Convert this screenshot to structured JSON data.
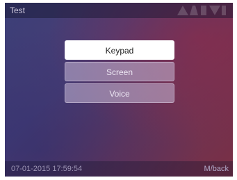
{
  "header": {
    "title": "Test"
  },
  "menu": {
    "items": [
      {
        "label": "Keypad",
        "selected": true
      },
      {
        "label": "Screen",
        "selected": false
      },
      {
        "label": "Voice",
        "selected": false
      }
    ]
  },
  "footer": {
    "datetime": "07-01-2015 17:59:54",
    "back_label": "M/back"
  },
  "colors": {
    "selected_bg": "#ffffff",
    "item_bg": "#b4a6c6",
    "screen_bg_start": "#3b3f78",
    "screen_bg_end": "#7a2f45"
  }
}
